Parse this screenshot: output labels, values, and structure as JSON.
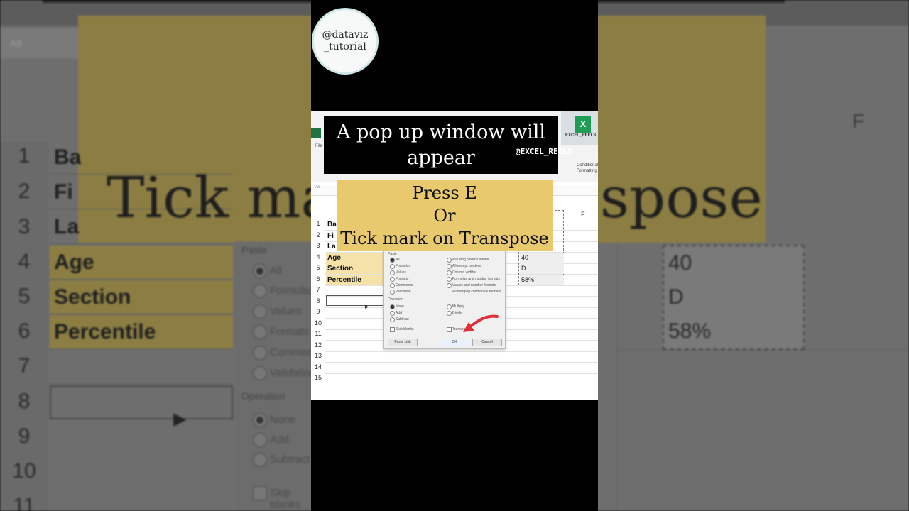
{
  "logo": {
    "line1": "@dataviz",
    "line2": "_tutorial"
  },
  "captions": {
    "top": "A pop up window will appear",
    "instruction": [
      "Press E",
      "Or",
      "Tick mark on Transpose"
    ]
  },
  "watermark": "@EXCEL_REELS",
  "sheet": {
    "name_box": "A8",
    "column_f": "F",
    "rows": [
      {
        "num": "1",
        "label": "Ba"
      },
      {
        "num": "2",
        "label": "Fi"
      },
      {
        "num": "3",
        "label": "La"
      },
      {
        "num": "4",
        "label": "Age"
      },
      {
        "num": "5",
        "label": "Section"
      },
      {
        "num": "6",
        "label": "Percentile"
      },
      {
        "num": "7",
        "label": ""
      },
      {
        "num": "8",
        "label": ""
      },
      {
        "num": "9",
        "label": ""
      },
      {
        "num": "10",
        "label": ""
      },
      {
        "num": "11",
        "label": ""
      },
      {
        "num": "12",
        "label": ""
      },
      {
        "num": "13",
        "label": ""
      },
      {
        "num": "14",
        "label": ""
      },
      {
        "num": "15",
        "label": ""
      }
    ],
    "values": [
      "40",
      "D",
      "58%"
    ]
  },
  "background": {
    "big_left": "Tick ma",
    "big_right": "spose",
    "paste_label": "Paste",
    "operation_label": "Operation",
    "paste_options": [
      "All",
      "Formulas",
      "Values",
      "Formats",
      "Comments",
      "Validation"
    ],
    "operation_options": [
      "None",
      "Add",
      "Subtract"
    ],
    "skip_blanks": "Skip blanks"
  },
  "dialog": {
    "paste_label": "Paste",
    "paste_left": [
      "All",
      "Formulas",
      "Values",
      "Formats",
      "Comments",
      "Validation"
    ],
    "paste_right": [
      "All using Source theme",
      "All except borders",
      "Column widths",
      "Formulas and number formats",
      "Values and number formats",
      "All merging conditional formats"
    ],
    "operation_label": "Operation",
    "op_left": [
      "None",
      "Add",
      "Subtract"
    ],
    "op_right": [
      "Multiply",
      "Divide"
    ],
    "skip_blanks": "Skip blanks",
    "transpose": "Transpose",
    "paste_link": "Paste Link",
    "ok": "OK",
    "cancel": "Cancel"
  },
  "excel_badge": {
    "letter": "X",
    "label": "EXCEL_REELS"
  },
  "ribbon": {
    "file": "File",
    "conditional": "Conditional Formatting"
  }
}
